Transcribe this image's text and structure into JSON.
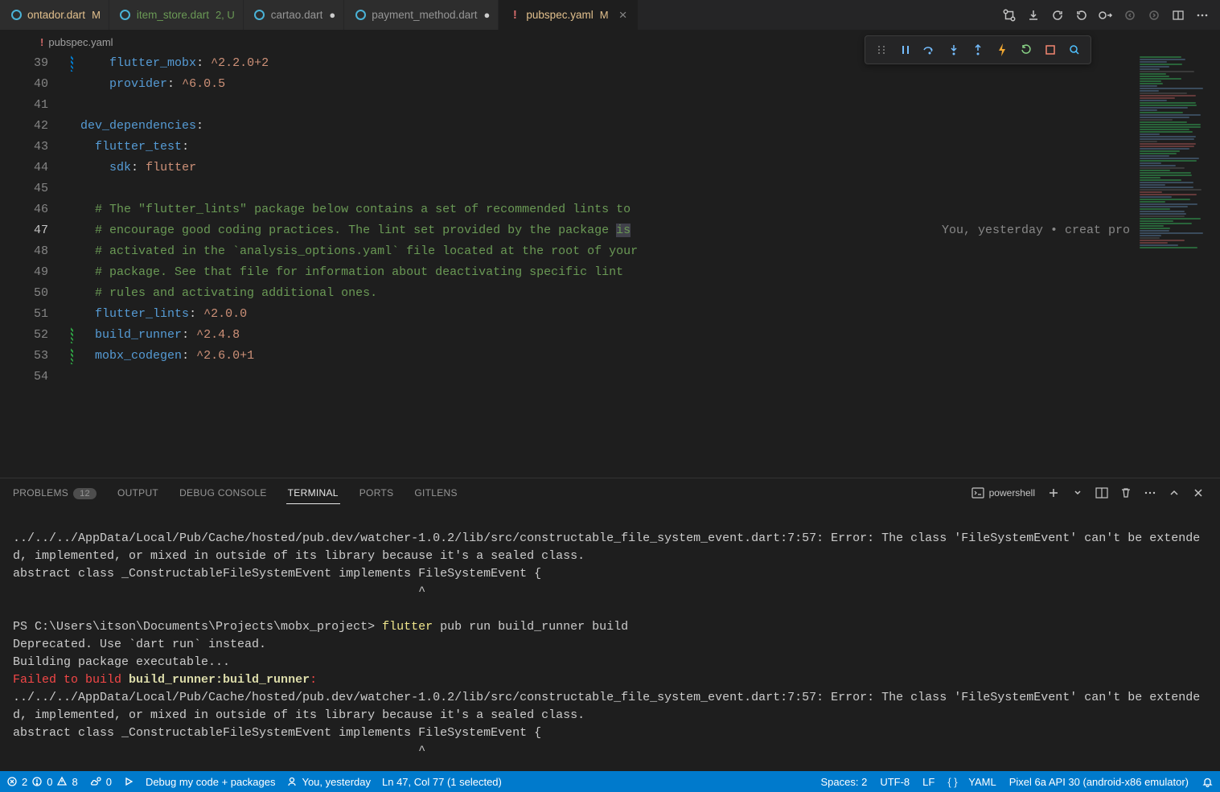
{
  "tabs": [
    {
      "icon": "dart",
      "iconColor": "#4AB2D6",
      "label": "ontador.dart",
      "status": "M",
      "statusColor": "#e2c08d",
      "close": "",
      "active": false
    },
    {
      "icon": "dart",
      "iconColor": "#4AB2D6",
      "label": "item_store.dart",
      "status": "2, U",
      "statusColor": "#6a9955",
      "labelColor": "#6a9955",
      "close": "",
      "active": false
    },
    {
      "icon": "dart",
      "iconColor": "#4AB2D6",
      "label": "cartao.dart",
      "status": "●",
      "statusColor": "#cccccc",
      "close": "",
      "active": false
    },
    {
      "icon": "dart",
      "iconColor": "#4AB2D6",
      "label": "payment_method.dart",
      "status": "●",
      "statusColor": "#cccccc",
      "close": "",
      "active": false
    },
    {
      "icon": "yaml",
      "iconColor": "#d16969",
      "label": "pubspec.yaml",
      "status": "M",
      "statusColor": "#e2c08d",
      "close": "×",
      "active": true
    }
  ],
  "breadcrumb": {
    "file": "pubspec.yaml"
  },
  "editor": {
    "startLine": 39,
    "currentLine": 47,
    "codelens": "You, yesterday • creat pro",
    "lines": [
      {
        "tokens": [
          {
            "t": "    ",
            "c": "wt"
          },
          {
            "t": "flutter_mobx",
            "c": "key"
          },
          {
            "t": ": ",
            "c": "wt"
          },
          {
            "t": "^2.2.0+2",
            "c": "str"
          }
        ],
        "git": "mod"
      },
      {
        "tokens": [
          {
            "t": "    ",
            "c": "wt"
          },
          {
            "t": "provider",
            "c": "key"
          },
          {
            "t": ": ",
            "c": "wt"
          },
          {
            "t": "^6.0.5",
            "c": "str"
          }
        ]
      },
      {
        "tokens": []
      },
      {
        "tokens": [
          {
            "t": "dev_dependencies",
            "c": "key"
          },
          {
            "t": ":",
            "c": "wt"
          }
        ]
      },
      {
        "tokens": [
          {
            "t": "  ",
            "c": "wt"
          },
          {
            "t": "flutter_test",
            "c": "key"
          },
          {
            "t": ":",
            "c": "wt"
          }
        ]
      },
      {
        "tokens": [
          {
            "t": "    ",
            "c": "wt"
          },
          {
            "t": "sdk",
            "c": "key"
          },
          {
            "t": ": ",
            "c": "wt"
          },
          {
            "t": "flutter",
            "c": "str"
          }
        ]
      },
      {
        "tokens": []
      },
      {
        "tokens": [
          {
            "t": "  ",
            "c": "wt"
          },
          {
            "t": "# The \"flutter_lints\" package below contains a set of recommended lints to",
            "c": "cmt"
          }
        ]
      },
      {
        "tokens": [
          {
            "t": "  ",
            "c": "wt"
          },
          {
            "t": "# encourage good coding practices. The lint set provided by the package ",
            "c": "cmt"
          },
          {
            "t": "is",
            "c": "cmt",
            "sel": true
          }
        ],
        "codelensRow": true
      },
      {
        "tokens": [
          {
            "t": "  ",
            "c": "wt"
          },
          {
            "t": "# activated in the `analysis_options.yaml` file located at the root of your",
            "c": "cmt"
          }
        ]
      },
      {
        "tokens": [
          {
            "t": "  ",
            "c": "wt"
          },
          {
            "t": "# package. See that file for information about deactivating specific lint",
            "c": "cmt"
          }
        ]
      },
      {
        "tokens": [
          {
            "t": "  ",
            "c": "wt"
          },
          {
            "t": "# rules and activating additional ones.",
            "c": "cmt"
          }
        ]
      },
      {
        "tokens": [
          {
            "t": "  ",
            "c": "wt"
          },
          {
            "t": "flutter_lints",
            "c": "key"
          },
          {
            "t": ": ",
            "c": "wt"
          },
          {
            "t": "^2.0.0",
            "c": "str"
          }
        ]
      },
      {
        "tokens": [
          {
            "t": "  ",
            "c": "wt"
          },
          {
            "t": "build_runner",
            "c": "key"
          },
          {
            "t": ": ",
            "c": "wt"
          },
          {
            "t": "^2.4.8",
            "c": "str"
          }
        ],
        "git": "add"
      },
      {
        "tokens": [
          {
            "t": "  ",
            "c": "wt"
          },
          {
            "t": "mobx_codegen",
            "c": "key"
          },
          {
            "t": ": ",
            "c": "wt"
          },
          {
            "t": "^2.6.0+1",
            "c": "str"
          }
        ],
        "git": "add"
      },
      {
        "tokens": []
      }
    ]
  },
  "panel": {
    "tabs": [
      {
        "label": "PROBLEMS",
        "badge": "12"
      },
      {
        "label": "OUTPUT"
      },
      {
        "label": "DEBUG CONSOLE"
      },
      {
        "label": "TERMINAL",
        "active": true
      },
      {
        "label": "PORTS"
      },
      {
        "label": "GITLENS"
      }
    ],
    "terminalLabel": "powershell",
    "terminal": {
      "l1": "../../../AppData/Local/Pub/Cache/hosted/pub.dev/watcher-1.0.2/lib/src/constructable_file_system_event.dart:7:57: Error: The class 'FileSystemEvent' can't be extended, implemented, or mixed in outside of its library because it's a sealed class.",
      "l2": "abstract class _ConstructableFileSystemEvent implements FileSystemEvent {",
      "l3": "                                                        ^",
      "promptPath": "PS C:\\Users\\itson\\Documents\\Projects\\mobx_project> ",
      "cmd1": "flutter",
      "cmd1b": " pub run build_runner build",
      "l4": "Deprecated. Use `dart run` instead.",
      "l5": "Building package executable...",
      "l6a": "Failed to build ",
      "l6b": "build_runner:build_runner",
      "l6c": ":",
      "l7": "../../../AppData/Local/Pub/Cache/hosted/pub.dev/watcher-1.0.2/lib/src/constructable_file_system_event.dart:7:57: Error: The class 'FileSystemEvent' can't be extended, implemented, or mixed in outside of its library because it's a sealed class.",
      "l8": "abstract class _ConstructableFileSystemEvent implements FileSystemEvent {",
      "l9": "                                                        ^"
    }
  },
  "status": {
    "errors": "2",
    "warnings": "0",
    "info": "8",
    "radio": "0",
    "debug": "Debug my code + packages",
    "blame": "You, yesterday",
    "selection": "Ln 47, Col 77 (1 selected)",
    "spaces": "Spaces: 2",
    "encoding": "UTF-8",
    "eol": "LF",
    "lang": "YAML",
    "device": "Pixel 6a API 30 (android-x86 emulator)"
  }
}
